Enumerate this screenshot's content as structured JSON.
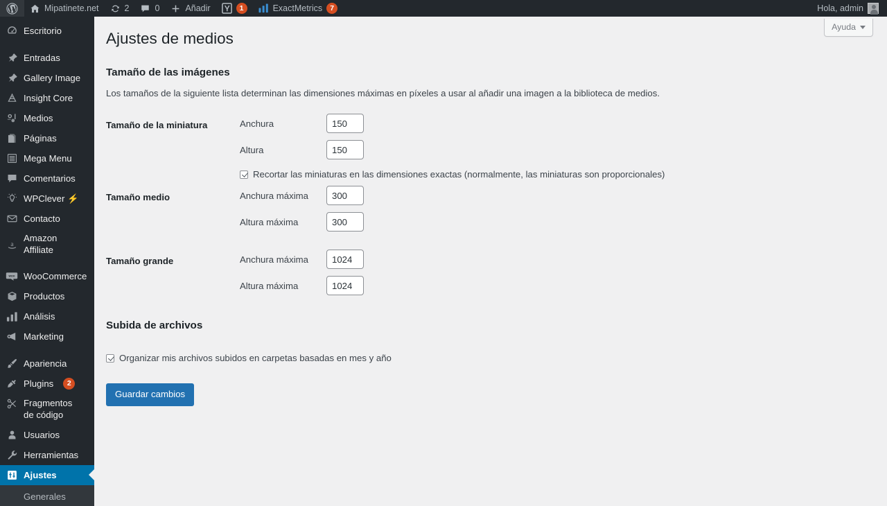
{
  "adminbar": {
    "wp_logo": "wordpress-logo-icon",
    "site_name": "Mipatinete.net",
    "updates_count": "2",
    "comments_count": "0",
    "new_label": "Añadir",
    "yoast_badge": "1",
    "exactmetrics_label": "ExactMetrics",
    "exactmetrics_badge": "7",
    "greeting": "Hola, admin"
  },
  "sidebar": {
    "items": [
      {
        "label": "Escritorio",
        "icon": "dashboard-icon",
        "current": false,
        "badge": ""
      },
      {
        "label": "Entradas",
        "icon": "pin-icon",
        "current": false,
        "badge": ""
      },
      {
        "label": "Gallery Image",
        "icon": "pin-icon",
        "current": false,
        "badge": ""
      },
      {
        "label": "Insight Core",
        "icon": "insight-icon",
        "current": false,
        "badge": ""
      },
      {
        "label": "Medios",
        "icon": "media-icon",
        "current": false,
        "badge": ""
      },
      {
        "label": "Páginas",
        "icon": "pages-icon",
        "current": false,
        "badge": ""
      },
      {
        "label": "Mega Menu",
        "icon": "menu-list-icon",
        "current": false,
        "badge": ""
      },
      {
        "label": "Comentarios",
        "icon": "comment-icon",
        "current": false,
        "badge": ""
      },
      {
        "label": "WPClever ⚡",
        "icon": "lightbulb-icon",
        "current": false,
        "badge": ""
      },
      {
        "label": "Contacto",
        "icon": "envelope-icon",
        "current": false,
        "badge": ""
      },
      {
        "label": "Amazon Affiliate",
        "icon": "amazon-icon",
        "current": false,
        "badge": ""
      },
      {
        "label": "WooCommerce",
        "icon": "woocommerce-icon",
        "current": false,
        "badge": ""
      },
      {
        "label": "Productos",
        "icon": "box-icon",
        "current": false,
        "badge": ""
      },
      {
        "label": "Análisis",
        "icon": "bar-chart-icon",
        "current": false,
        "badge": ""
      },
      {
        "label": "Marketing",
        "icon": "megaphone-icon",
        "current": false,
        "badge": ""
      },
      {
        "label": "Apariencia",
        "icon": "paintbrush-icon",
        "current": false,
        "badge": ""
      },
      {
        "label": "Plugins",
        "icon": "plug-icon",
        "current": false,
        "badge": "2"
      },
      {
        "label": "Fragmentos de código",
        "icon": "scissors-icon",
        "current": false,
        "badge": ""
      },
      {
        "label": "Usuarios",
        "icon": "user-icon",
        "current": false,
        "badge": ""
      },
      {
        "label": "Herramientas",
        "icon": "wrench-icon",
        "current": false,
        "badge": ""
      },
      {
        "label": "Ajustes",
        "icon": "settings-icon",
        "current": true,
        "badge": ""
      }
    ],
    "submenu": [
      {
        "label": "Generales"
      }
    ]
  },
  "help": {
    "label": "Ayuda"
  },
  "page": {
    "title": "Ajustes de medios",
    "image_sizes_heading": "Tamaño de las imágenes",
    "image_sizes_desc": "Los tamaños de la siguiente lista determinan las dimensiones máximas en píxeles a usar al añadir una imagen a la biblioteca de medios.",
    "rows": [
      {
        "th": "Tamaño de la miniatura",
        "fields": [
          {
            "label": "Anchura",
            "value": "150",
            "name": "thumbnail-width-input"
          },
          {
            "label": "Altura",
            "value": "150",
            "name": "thumbnail-height-input"
          }
        ],
        "checkbox": {
          "label": "Recortar las miniaturas en las dimensiones exactas (normalmente, las miniaturas son proporcionales)",
          "checked": true
        }
      },
      {
        "th": "Tamaño medio",
        "fields": [
          {
            "label": "Anchura máxima",
            "value": "300",
            "name": "medium-width-input"
          },
          {
            "label": "Altura máxima",
            "value": "300",
            "name": "medium-height-input"
          }
        ],
        "checkbox": null
      },
      {
        "th": "Tamaño grande",
        "fields": [
          {
            "label": "Anchura máxima",
            "value": "1024",
            "name": "large-width-input"
          },
          {
            "label": "Altura máxima",
            "value": "1024",
            "name": "large-height-input"
          }
        ],
        "checkbox": null
      }
    ],
    "uploads_heading": "Subida de archivos",
    "uploads_checkbox": {
      "label": "Organizar mis archivos subidos en carpetas basadas en mes y año",
      "checked": true
    },
    "save_label": "Guardar cambios"
  },
  "colors": {
    "admin_bar": "#23282d",
    "sidebar": "#23282d",
    "current_menu": "#0073aa",
    "badge": "#d54e21",
    "primary_button": "#2271b1",
    "page_bg": "#f0f0f1",
    "exactmetrics_icon": "#3a8fd4"
  }
}
